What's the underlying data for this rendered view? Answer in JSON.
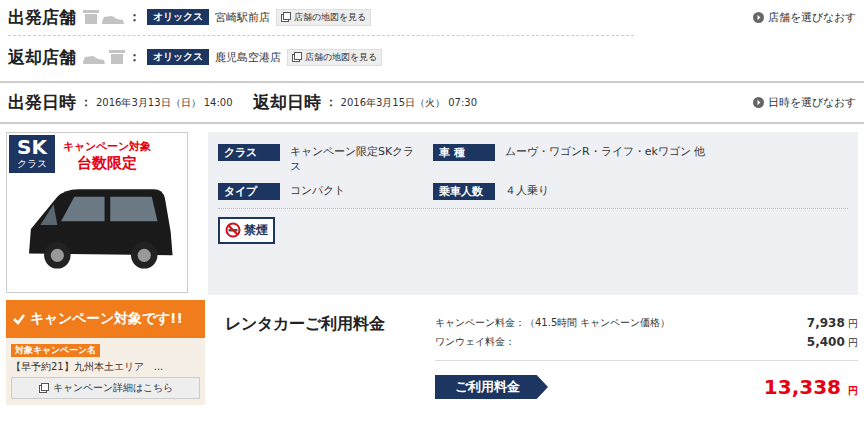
{
  "stores": [
    {
      "label": "出発店舗",
      "colon": "：",
      "brand": "オリックス",
      "name": "宮崎駅前店",
      "map_button": "店舗の地図を見る",
      "direction": "depart"
    },
    {
      "label": "返却店舗",
      "colon": "：",
      "brand": "オリックス",
      "name": "鹿児島空港店",
      "map_button": "店舗の地図を見る",
      "direction": "return"
    }
  ],
  "reselect_store": "店舗を選びなおす",
  "datetimes": [
    {
      "label": "出発日時",
      "colon": "：",
      "value": "2016年3月13日（日） 14:00"
    },
    {
      "label": "返却日時",
      "colon": "：",
      "value": "2016年3月15日（火） 07:30"
    }
  ],
  "reselect_datetime": "日時を選びなおす",
  "car": {
    "class_badge": "SK",
    "class_badge_sub": "クラス",
    "promo_lines": [
      "キャンペーン対象",
      "台数限定"
    ],
    "specs": [
      {
        "label": "クラス",
        "value": "キャンペーン限定SKクラス"
      },
      {
        "label": "車 種",
        "value": "ムーヴ・ワゴンR・ライフ・ekワゴン 他"
      },
      {
        "label": "タイプ",
        "value": "コンパクト"
      },
      {
        "label": "乗車人数",
        "value": "４人乗り"
      }
    ],
    "smoking": "禁煙"
  },
  "campaign": {
    "banner": "キャンペーン対象です!!",
    "name_label": "対象キャンペーン名",
    "name": "【早予約21】九州本土エリア　...",
    "detail_button": "キャンペーン詳細はこちら"
  },
  "fees": {
    "title": "レンタカーご利用料金",
    "rows": [
      {
        "label": "キャンペーン料金：（41.5時間 キャンペーン価格）",
        "amount": "7,938",
        "unit": "円"
      },
      {
        "label": "ワンウェイ料金：",
        "amount": "5,400",
        "unit": "円"
      }
    ],
    "total_label": "ご利用料金",
    "total": "13,338",
    "total_unit": "円"
  }
}
